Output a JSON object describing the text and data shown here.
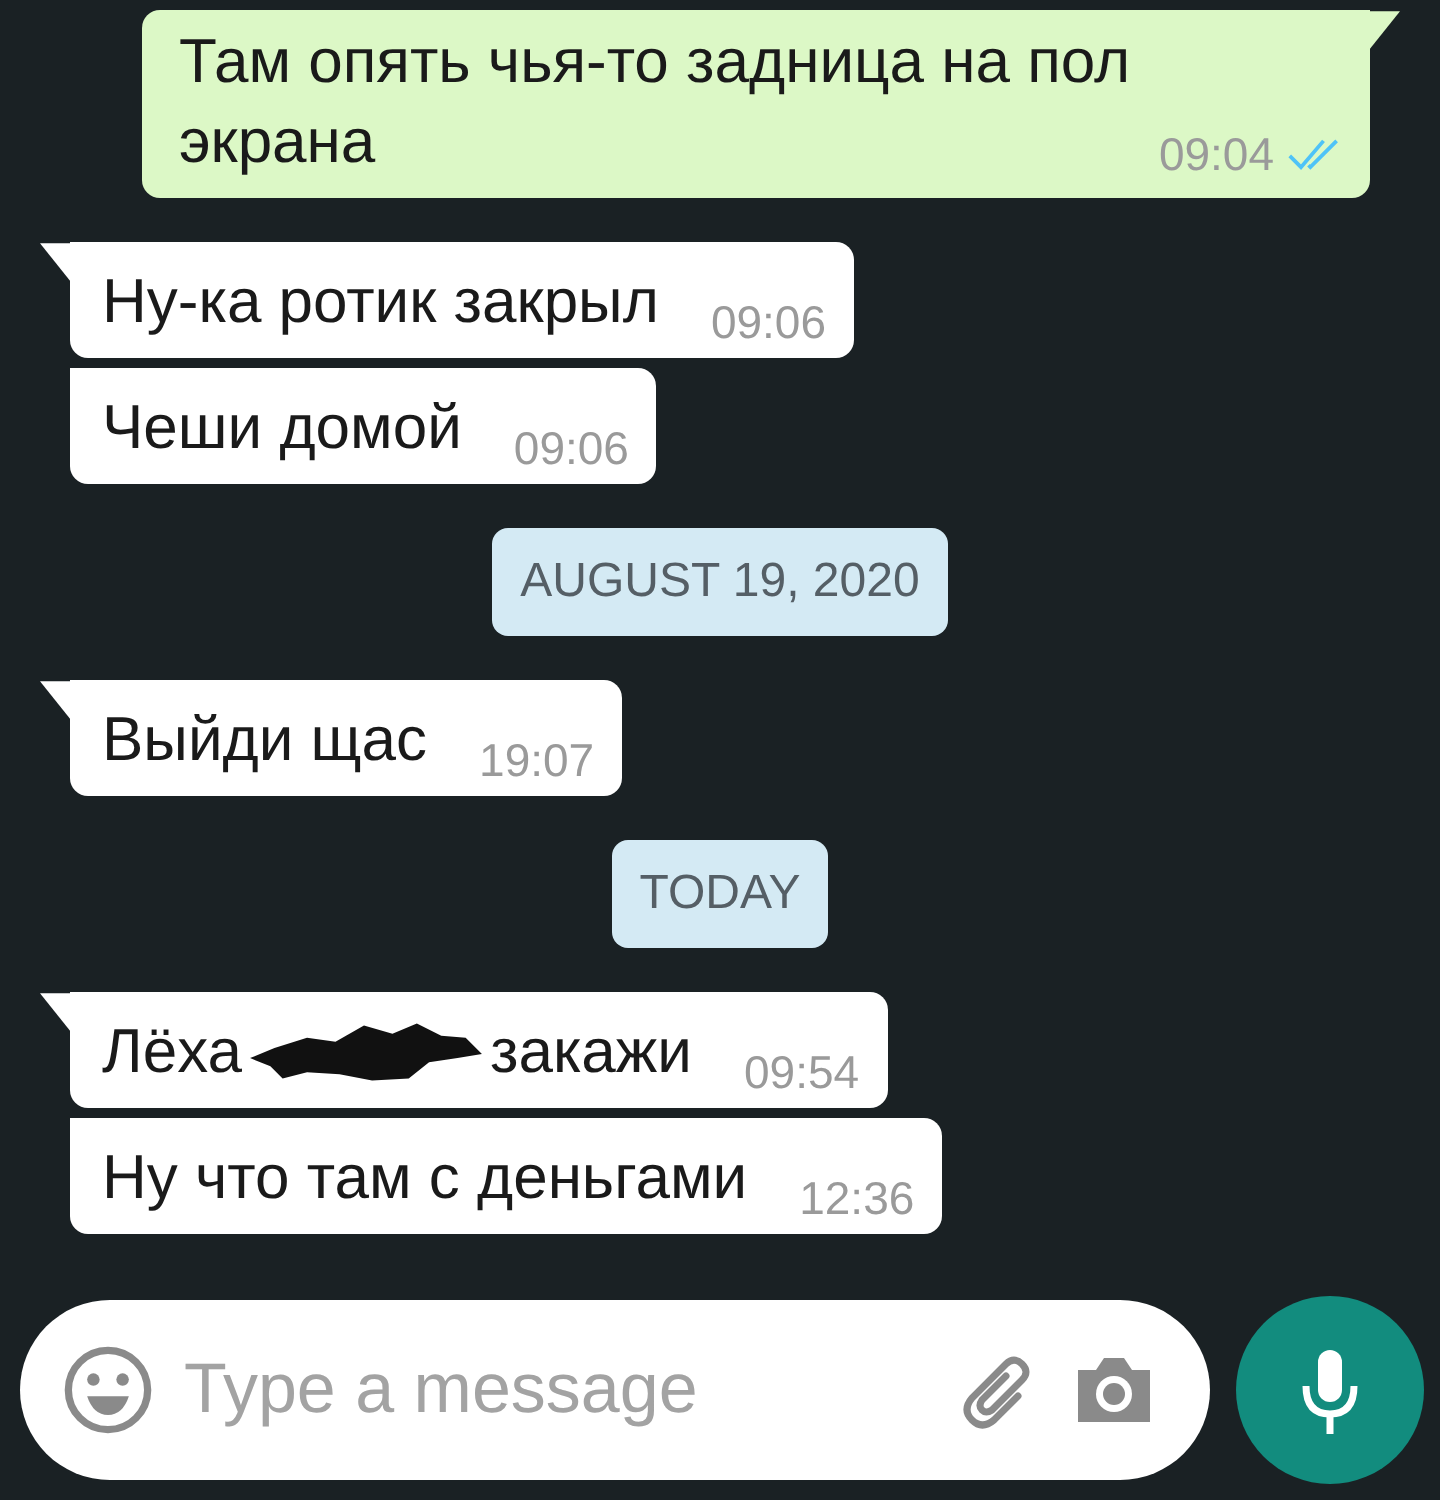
{
  "messages": [
    {
      "kind": "message",
      "outgoing": true,
      "tail": true,
      "text": "Там опять чья-то задница на пол экрана",
      "time": "09:04",
      "read": true
    },
    {
      "kind": "message",
      "outgoing": false,
      "tail": true,
      "text": "Ну-ка ротик закрыл",
      "time": "09:06"
    },
    {
      "kind": "message",
      "outgoing": false,
      "tail": false,
      "text": "Чеши домой",
      "time": "09:06"
    },
    {
      "kind": "date",
      "label": "AUGUST 19, 2020"
    },
    {
      "kind": "message",
      "outgoing": false,
      "tail": true,
      "text": "Выйди щас",
      "time": "19:07"
    },
    {
      "kind": "date",
      "label": "TODAY"
    },
    {
      "kind": "message",
      "outgoing": false,
      "tail": true,
      "parts": [
        {
          "kind": "text",
          "text": "Лёха"
        },
        {
          "kind": "redaction"
        },
        {
          "kind": "text",
          "text": "закажи"
        }
      ],
      "time": "09:54"
    },
    {
      "kind": "message",
      "outgoing": false,
      "tail": false,
      "text": "Ну что там с деньгами",
      "time": "12:36"
    }
  ],
  "composer": {
    "placeholder": "Type a message"
  }
}
